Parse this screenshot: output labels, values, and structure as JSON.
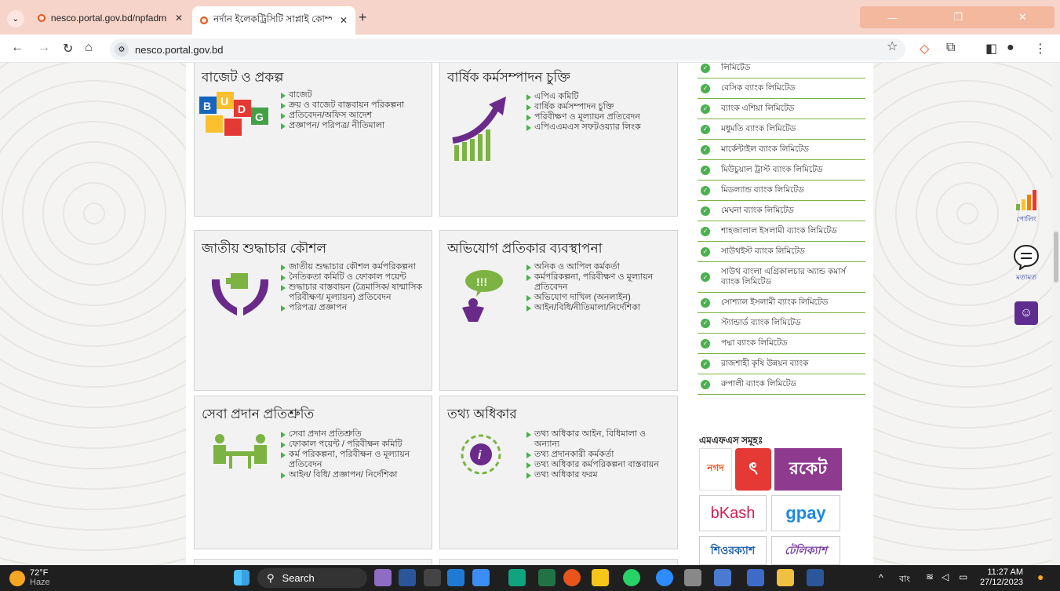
{
  "browser": {
    "tabs": [
      {
        "title": "nesco.portal.gov.bd/npfadmin/",
        "active": false
      },
      {
        "title": "নর্দান ইলেকট্রিসিটি সাপ্লাই কোম্প",
        "active": true
      }
    ],
    "new_tab": "+",
    "url": "nesco.portal.gov.bd"
  },
  "sections": [
    {
      "title": "বাজেট ও প্রকল্প",
      "art": "budget-icon",
      "items": [
        "বাজেট",
        "ক্রয় ও বাজেট বাস্তবায়ন পরিকল্পনা",
        "প্রতিবেদন/অফিস আদেশ",
        "প্রজ্ঞাপন/ পরিপত্র/ নীতিমালা"
      ]
    },
    {
      "title": "বার্ষিক কর্মসম্পাদন চুক্তি",
      "art": "growth-arrow-icon",
      "items": [
        "এপিএ কমিটি",
        "বার্ষিক কর্মসম্পাদন চুক্তি",
        "পরিবীক্ষণ ও মূল্যায়ন প্রতিবেদন",
        "এপিএএমএস সফটওয়্যার লিংক"
      ]
    },
    {
      "title": "জাতীয় শুদ্ধাচার কৌশল",
      "art": "hands-puzzle-icon",
      "items": [
        "জাতীয় শুদ্ধাচার কৌশল কর্মপরিকল্পনা",
        "নৈতিকতা কমিটি ও ফোকাল পয়েন্ট",
        "শুদ্ধাচার বাস্তবায়ন (ত্রৈমাসিক/ ষান্মাসিক পরিবীক্ষণ/ মূল্যায়ন) প্রতিবেদন",
        "পরিপত্র/ প্রজ্ঞাপন"
      ]
    },
    {
      "title": "অভিযোগ প্রতিকার ব্যবস্থাপনা",
      "art": "complaint-icon",
      "items": [
        "অনিক ও আপিল কর্মকর্তা",
        "কর্মপরিকল্পনা, পরিবীক্ষণ ও মূল্যায়ন প্রতিবেদন",
        "অভিযোগ দাখিল (অনলাইন)",
        "আইন/বিধি/নীতিমালা/নির্দেশিকা"
      ]
    },
    {
      "title": "সেবা প্রদান প্রতিশ্রুতি",
      "art": "service-desk-icon",
      "items": [
        "সেবা প্রদান প্রতিশ্রুতি",
        "ফোকাল পয়েন্ট / পরিবীক্ষন কমিটি",
        "কর্ম পরিকল্পনা, পরিবীক্ষন ও মূল্যায়ন প্রতিবেদন",
        "আইন/ বিধি/ প্রজ্ঞাপন/ নির্দেশিকা"
      ]
    },
    {
      "title": "তথ্য অধিকার",
      "art": "info-icon",
      "items": [
        "তথ্য অধিকার আইন, বিধিমালা ও অন্যান্য",
        "তথ্য প্রদানকারী কর্মকর্তা",
        "তথ্য অধিকার কর্মপরিকল্পনা বাস্তবায়ন",
        "তথ্য অধিকার ফরম"
      ]
    }
  ],
  "banks": [
    "লিমিটেড",
    "বেসিক ব্যাংক লিমিটেড",
    "ব্যাংক এশিয়া লিমিটেড",
    "মধুমতি ব্যাংক লিমিটেড",
    "মার্কেন্টাইল ব্যাংক লিমিটেড",
    "মিউচুয়াল ট্রাস্ট ব্যাংক লিমিটেড",
    "মিডল্যান্ড ব্যাংক লিমিটেড",
    "মেঘনা ব্যাংক লিমিটেড",
    "শাহজালাল ইসলামী ব্যাংক লিমিটেড",
    "সাউথইস্ট ব্যাংক লিমিটেড",
    "সাউথ বাংলা এগ্রিকালচার অ্যান্ড কমার্স ব্যাংক লিমিটেড",
    "সোশ্যাল ইসলামী ব্যাংক লিমিটেড",
    "স্ট্যান্ডার্ড ব্যাংক লিমিটেড",
    "পদ্মা ব্যাংক লিমিটেড",
    "রাজশাহী কৃষি উন্নয়ন ব্যাংক",
    "রুপালী ব্যাংক লিমিটেড"
  ],
  "mfs": {
    "title": "এমএফএস সমূহঃ",
    "logos": [
      {
        "text": "নগদ",
        "color": "#e8541c"
      },
      {
        "text": "ৎ",
        "color": "#e53935"
      },
      {
        "text": "রকেট",
        "color": "#8e3a8f"
      },
      {
        "text": "bKash",
        "color": "#d12053"
      },
      {
        "text": "gpay",
        "color": "#1e88e5"
      },
      {
        "text": "শিওরক্যাশ",
        "color": "#1a5fa8"
      },
      {
        "text": "টেলিক্যাশ",
        "color": "#7b3fa0"
      }
    ]
  },
  "widgets": {
    "poll_label": "পোলিং",
    "feedback_label": "মতামত"
  },
  "taskbar": {
    "weather_temp": "72°F",
    "weather_text": "Haze",
    "search_label": "Search",
    "lang": "বাং",
    "time": "11:27 AM",
    "date": "27/12/2023"
  }
}
